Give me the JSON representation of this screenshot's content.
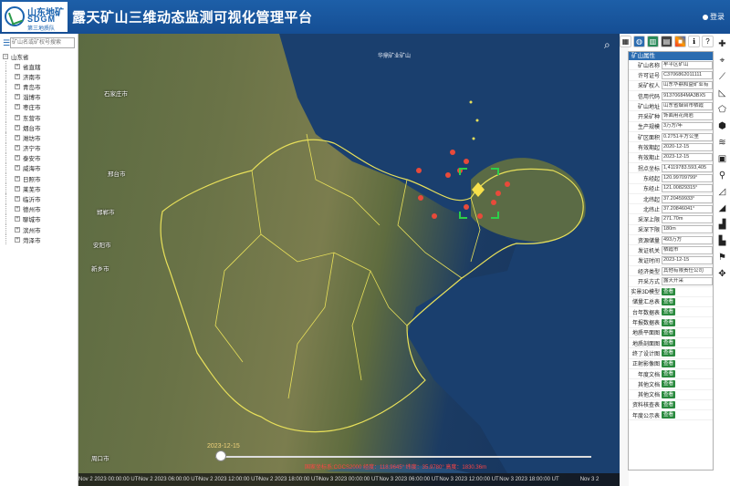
{
  "header": {
    "logo_line1": "山东地矿",
    "logo_line2": "SDGM",
    "logo_line3": "第三地质队",
    "title": "露天矿山三维动态监测可视化管理平台",
    "login_label": "登录"
  },
  "left_panel": {
    "search_placeholder": "矿山名或矿权号搜索",
    "tree_root": "山东省",
    "tree_items": [
      "省直辖",
      "济南市",
      "青岛市",
      "淄博市",
      "枣庄市",
      "东营市",
      "烟台市",
      "潍坊市",
      "济宁市",
      "泰安市",
      "威海市",
      "日照市",
      "莱芜市",
      "临沂市",
      "德州市",
      "聊城市",
      "滨州市",
      "菏泽市"
    ]
  },
  "map": {
    "sea_label": "华鼎矿业矿山",
    "cities": {
      "shijiazhuang": "石家庄市",
      "xingtai": "邢台市",
      "handan": "邯郸市",
      "anyang": "安阳市",
      "xinxiang": "新乡市",
      "zhoukou": "周口市"
    },
    "timeline_date": "2023-12-15",
    "coords_text": "国家坐标系:CGCS2000 经度：118.9645° 纬度：35.9780° 高度：1830.36m",
    "axis_ticks": [
      "Nov 2 2023 00:00:00 UTC",
      "Nov 2 2023 06:00:00 UTC",
      "Nov 2 2023 12:00:00 UTC",
      "Nov 2 2023 18:00:00 UTC",
      "Nov 3 2023 00:00:00 UTC",
      "Nov 3 2023 06:00:00 UTC",
      "Nov 3 2023 12:00:00 UTC",
      "Nov 3 2023 18:00:00 UTC",
      "Nov 3 2"
    ]
  },
  "attributes": {
    "panel_title": "矿山属性",
    "rows": [
      {
        "k": "矿山名称",
        "v": "牟平区矿山"
      },
      {
        "k": "许可证号",
        "v": "C3706862011111"
      },
      {
        "k": "采矿权人",
        "v": "山东华鼎和益矿业有"
      },
      {
        "k": "信用代码",
        "v": "91370684MA3BX5"
      },
      {
        "k": "矿山地址",
        "v": "山东省烟台市栖霞"
      },
      {
        "k": "开采矿种",
        "v": "饰面用花岗岩"
      },
      {
        "k": "生产规模",
        "v": "3万方/年"
      },
      {
        "k": "矿区面积",
        "v": "0.2751平方公里"
      },
      {
        "k": "有效期起",
        "v": "2020-12-15"
      },
      {
        "k": "有效期止",
        "v": "2023-12-15"
      },
      {
        "k": "拐点坐标",
        "v": "1,4119783.593,405"
      },
      {
        "k": "东经起",
        "v": "120.99709799°"
      },
      {
        "k": "东经止",
        "v": "121.00829315°"
      },
      {
        "k": "北纬起",
        "v": "37.20459933°"
      },
      {
        "k": "北纬止",
        "v": "37.20846041°"
      },
      {
        "k": "采深上限",
        "v": "271.70m"
      },
      {
        "k": "采深下限",
        "v": "180m"
      },
      {
        "k": "资源储量",
        "v": "493万方"
      },
      {
        "k": "发证机关",
        "v": "栖霞市"
      },
      {
        "k": "发证时间",
        "v": "2023-12-15"
      },
      {
        "k": "经济类型",
        "v": "其他有限责任公司"
      },
      {
        "k": "开采方式",
        "v": "露天开采"
      }
    ],
    "query_rows": [
      {
        "k": "实景3D模型",
        "b": "查看"
      },
      {
        "k": "储量汇总表",
        "b": "查看"
      },
      {
        "k": "台年数据表",
        "b": "查看"
      },
      {
        "k": "年报数据表",
        "b": "查看"
      },
      {
        "k": "地质平面图",
        "b": "查看"
      },
      {
        "k": "地质剖面图",
        "b": "查看"
      },
      {
        "k": "终了设计图",
        "b": "查看"
      },
      {
        "k": "正射影像图",
        "b": "查看"
      },
      {
        "k": "年度文档",
        "b": "查看"
      },
      {
        "k": "其他文档",
        "b": "查看"
      },
      {
        "k": "其他文档",
        "b": "查看"
      },
      {
        "k": "资料核查表",
        "b": "查看"
      },
      {
        "k": "年度公示表",
        "b": "查看"
      }
    ]
  },
  "colors": {
    "header": "#1d5fa8",
    "boundary": "#e8e05a",
    "mine_marker": "#e84a3a",
    "selection": "#2bd04a",
    "query_button": "#2a8a3e"
  }
}
